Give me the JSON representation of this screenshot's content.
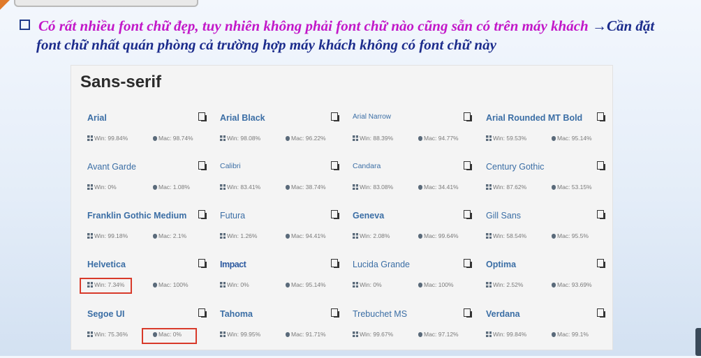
{
  "slide": {
    "line1_pink": "Có rất nhiều font chữ đẹp, tuy nhiên không phải font chữ nào cũng sẵn có trên máy khách",
    "arrow": "→",
    "line1_navy": "Cần đặt",
    "line2": "font chữ nhất quán phòng cả trường hợp máy khách không có font chữ này"
  },
  "panel": {
    "title": "Sans-serif"
  },
  "fonts": [
    {
      "name": "Arial",
      "win": "Win: 99.84%",
      "mac": "Mac: 98.74%"
    },
    {
      "name": "Arial Black",
      "win": "Win: 98.08%",
      "mac": "Mac: 96.22%"
    },
    {
      "name": "Arial Narrow",
      "win": "Win: 88.39%",
      "mac": "Mac: 94.77%"
    },
    {
      "name": "Arial Rounded MT Bold",
      "win": "Win: 59.53%",
      "mac": "Mac: 95.14%"
    },
    {
      "name": "Avant Garde",
      "win": "Win: 0%",
      "mac": "Mac: 1.08%"
    },
    {
      "name": "Calibri",
      "win": "Win: 83.41%",
      "mac": "Mac: 38.74%"
    },
    {
      "name": "Candara",
      "win": "Win: 83.08%",
      "mac": "Mac: 34.41%"
    },
    {
      "name": "Century Gothic",
      "win": "Win: 87.62%",
      "mac": "Mac: 53.15%"
    },
    {
      "name": "Franklin Gothic Medium",
      "win": "Win: 99.18%",
      "mac": "Mac: 2.1%"
    },
    {
      "name": "Futura",
      "win": "Win: 1.26%",
      "mac": "Mac: 94.41%"
    },
    {
      "name": "Geneva",
      "win": "Win: 2.08%",
      "mac": "Mac: 99.64%"
    },
    {
      "name": "Gill Sans",
      "win": "Win: 58.54%",
      "mac": "Mac: 95.5%"
    },
    {
      "name": "Helvetica",
      "win": "Win: 7.34%",
      "mac": "Mac: 100%"
    },
    {
      "name": "Impact",
      "win": "Win: 0%",
      "mac": "Mac: 95.14%"
    },
    {
      "name": "Lucida Grande",
      "win": "Win: 0%",
      "mac": "Mac: 100%"
    },
    {
      "name": "Optima",
      "win": "Win: 2.52%",
      "mac": "Mac: 93.69%"
    },
    {
      "name": "Segoe UI",
      "win": "Win: 75.36%",
      "mac": "Mac: 0%"
    },
    {
      "name": "Tahoma",
      "win": "Win: 99.95%",
      "mac": "Mac: 91.71%"
    },
    {
      "name": "Trebuchet MS",
      "win": "Win: 99.67%",
      "mac": "Mac: 97.12%"
    },
    {
      "name": "Verdana",
      "win": "Win: 99.84%",
      "mac": "Mac: 99.1%"
    }
  ],
  "icons": {
    "copy": "copy-icon",
    "windows": "windows-icon",
    "apple": "apple-icon",
    "bullet": "checkbox-bullet-icon"
  },
  "colors": {
    "pink_text": "#c218c8",
    "navy_text": "#1c2c8c",
    "font_link": "#3b6ea5",
    "highlight": "#d83a2a"
  }
}
